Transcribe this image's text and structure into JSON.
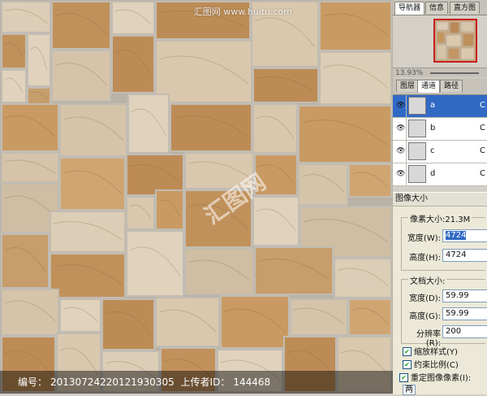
{
  "canvas": {
    "site_watermark": "汇图网 www.huitu.com",
    "center_watermark": "汇图网",
    "id_bar": {
      "number_label": "编号：",
      "number": "20130724220121930305",
      "uploader_label": "上传者ID：",
      "uploader_id": "144468"
    }
  },
  "navigator": {
    "tabs": [
      "导航器",
      "信息",
      "直方图"
    ],
    "zoom": "13.93%"
  },
  "layers_panel": {
    "tabs": [
      "图层",
      "通道",
      "路径"
    ],
    "channels": [
      {
        "name": "a",
        "key": "C"
      },
      {
        "name": "b",
        "key": "C"
      },
      {
        "name": "c",
        "key": "C"
      },
      {
        "name": "d",
        "key": "C"
      }
    ]
  },
  "image_size_dialog": {
    "title": "图像大小",
    "pixel_dimensions": "像素大小:21.3M",
    "width_label": "宽度(W):",
    "width_value": "4724",
    "height_label": "高度(H):",
    "height_value": "4724",
    "document_size": "文档大小:",
    "doc_width_label": "宽度(D):",
    "doc_width_value": "59.99",
    "doc_height_label": "高度(G):",
    "doc_height_value": "59.99",
    "resolution_label": "分辨率(R):",
    "resolution_value": "200",
    "scale_styles": "缩放样式(Y)",
    "constrain_proportions": "约束比例(C)",
    "resample": "重定图像像素(I):",
    "resample_value": "两"
  },
  "colors": {
    "selection": "#316ac5",
    "nav_frame": "#c81e1e",
    "stone_light": "#d9c9b2",
    "stone_warm": "#c89a65",
    "grout": "#b9b3a8"
  }
}
